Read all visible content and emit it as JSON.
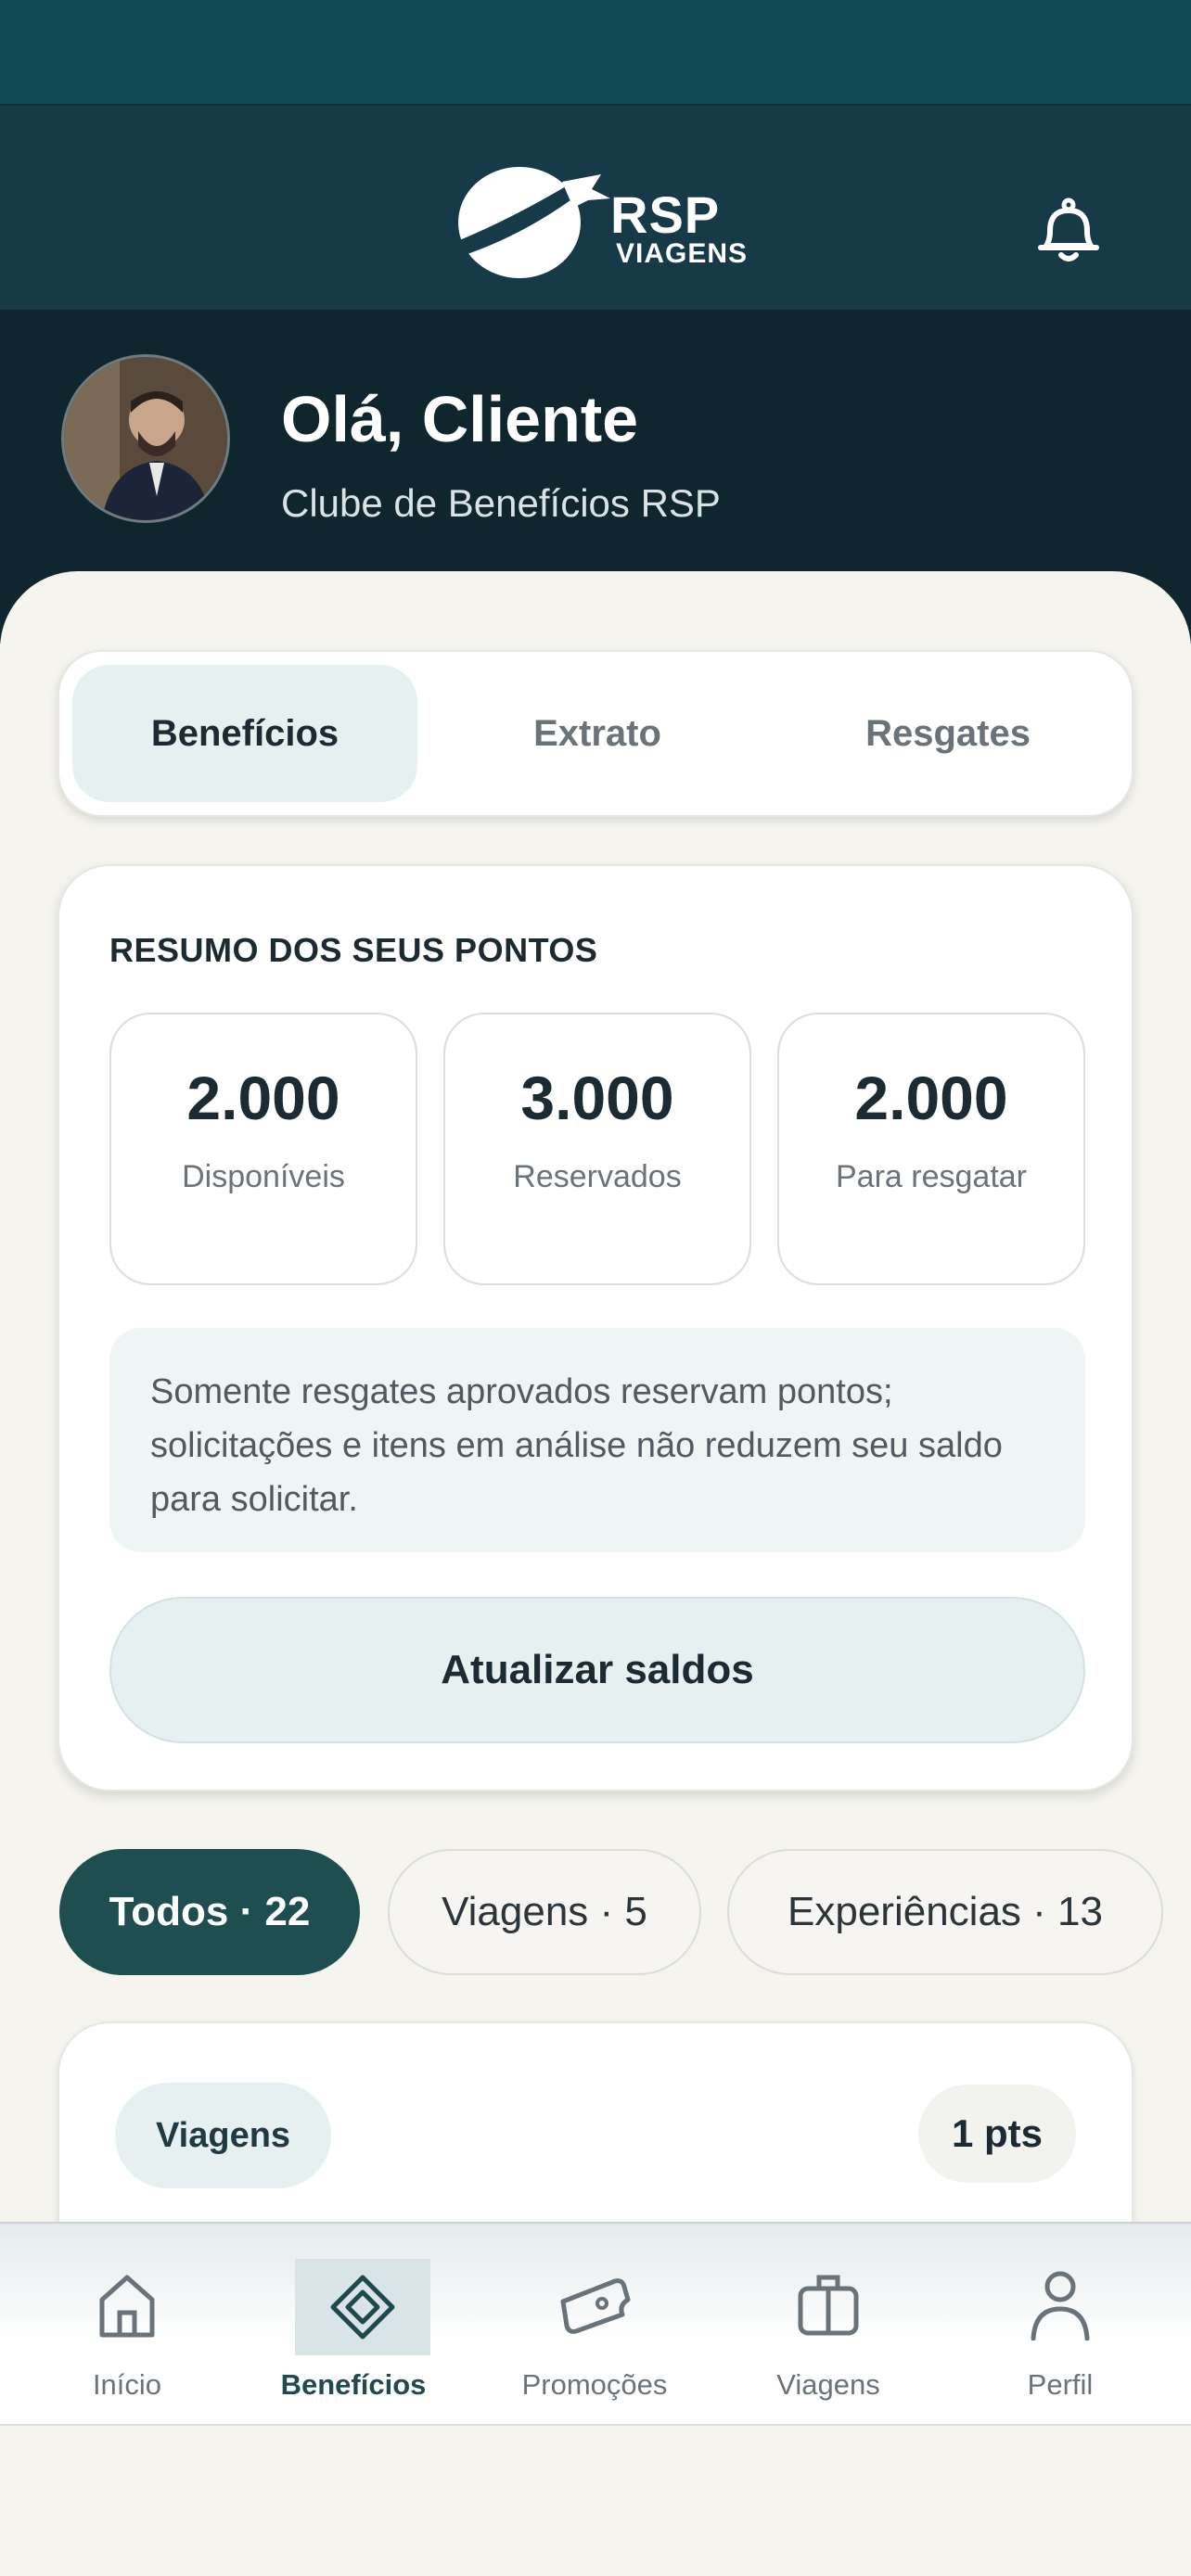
{
  "header": {
    "logo_text": "RSP",
    "logo_sub": "VIAGENS",
    "notification_icon": "bell-icon"
  },
  "profile": {
    "greeting": "Olá, Cliente",
    "subtitle": "Clube de Benefícios RSP"
  },
  "tabs": [
    {
      "label": "Benefícios",
      "active": true
    },
    {
      "label": "Extrato",
      "active": false
    },
    {
      "label": "Resgates",
      "active": false
    }
  ],
  "summary": {
    "title": "RESUMO DOS SEUS PONTOS",
    "points": [
      {
        "value": "2.000",
        "label": "Disponíveis"
      },
      {
        "value": "3.000",
        "label": "Reservados"
      },
      {
        "value": "2.000",
        "label": "Para resgatar"
      }
    ],
    "note": "Somente resgates aprovados reservam pontos; solicitações e itens em análise não reduzem seu saldo para solicitar.",
    "refresh_label": "Atualizar saldos"
  },
  "filters": [
    {
      "label": "Todos · 22",
      "active": true
    },
    {
      "label": "Viagens · 5",
      "active": false
    },
    {
      "label": "Experiências · 13",
      "active": false
    }
  ],
  "benefit_item": {
    "category": "Viagens",
    "points": "1 pts"
  },
  "bottom_nav": [
    {
      "label": "Início",
      "icon": "home-icon",
      "active": false
    },
    {
      "label": "Benefícios",
      "icon": "diamond-icon",
      "active": true
    },
    {
      "label": "Promoções",
      "icon": "ticket-icon",
      "active": false
    },
    {
      "label": "Viagens",
      "icon": "suitcase-icon",
      "active": false
    },
    {
      "label": "Perfil",
      "icon": "user-icon",
      "active": false
    }
  ],
  "colors": {
    "status_bar": "#0f4a52",
    "header": "#163a47",
    "profile_band": "#10262f",
    "accent": "#1f4e50",
    "accent_soft": "#e6f0f1",
    "background": "#f5f4ef"
  }
}
